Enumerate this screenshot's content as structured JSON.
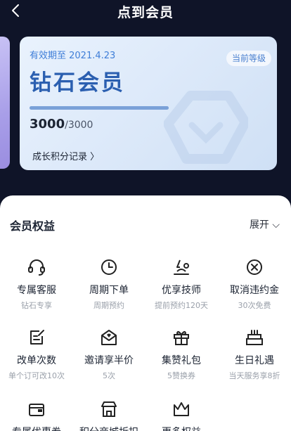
{
  "header": {
    "title": "点到会员",
    "back_icon": "chevron-left-icon"
  },
  "card": {
    "validity": "有效期至 2021.4.23",
    "level_tag": "当前等级",
    "level_name": "钻石会员",
    "progress_fraction": 1.0,
    "points_current": "3000",
    "points_separator": "/",
    "points_max": "3000",
    "record_link": "成长积分记录 〉"
  },
  "benefits": {
    "title": "会员权益",
    "expand": "展开 ⌵",
    "items": [
      {
        "label": "专属客服",
        "sub": "钻石专享",
        "icon": "headset-icon"
      },
      {
        "label": "周期下单",
        "sub": "周期预约",
        "icon": "clock-icon"
      },
      {
        "label": "优享技师",
        "sub": "提前预约120天",
        "icon": "technician-icon"
      },
      {
        "label": "取消违约金",
        "sub": "30次免费",
        "icon": "cancel-icon"
      },
      {
        "label": "改单次数",
        "sub": "单个订可改10次",
        "icon": "edit-order-icon"
      },
      {
        "label": "邀请享半价",
        "sub": "5次",
        "icon": "invite-mail-icon"
      },
      {
        "label": "集赞礼包",
        "sub": "5赞换券",
        "icon": "gift-icon"
      },
      {
        "label": "生日礼遇",
        "sub": "当天服务享8折",
        "icon": "birthday-cake-icon"
      },
      {
        "label": "专属优惠券",
        "sub": "",
        "icon": "wallet-icon"
      },
      {
        "label": "积分商城折扣",
        "sub": "",
        "icon": "store-icon"
      },
      {
        "label": "更多权益",
        "sub": "",
        "icon": "crown-icon"
      }
    ]
  },
  "colors": {
    "header_bg": "#0f1428",
    "card_accent": "#2b5fb0",
    "validity": "#3f7ed8"
  }
}
